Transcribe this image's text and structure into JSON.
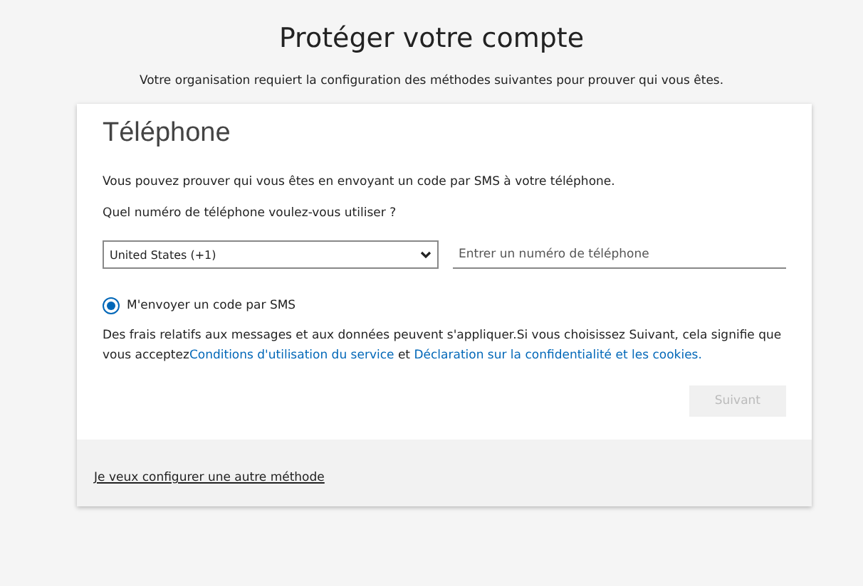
{
  "header": {
    "title": "Protéger votre compte",
    "subtitle": "Votre organisation requiert la configuration des méthodes suivantes pour prouver qui vous êtes."
  },
  "card": {
    "heading": "Téléphone",
    "intro": "Vous pouvez prouver qui vous êtes en envoyant un code par SMS à votre téléphone.",
    "question": "Quel numéro de téléphone voulez-vous utiliser ?",
    "country_select": {
      "value": "United States (+1)"
    },
    "phone_field": {
      "placeholder": "Entrer un numéro de téléphone"
    },
    "options": [
      {
        "label": "M'envoyer un code par SMS",
        "selected": true
      }
    ],
    "consent": {
      "text": "Des frais relatifs aux messages et aux données peuvent s'appliquer.Si vous choisissez Suivant, cela signifie que vous acceptez",
      "link_1": "Conditions d'utilisation du service",
      "joiner": " et ",
      "link_2": "Déclaration sur la confidentialité et les cookies."
    },
    "next_button": {
      "label": "Suivant",
      "disabled": true
    },
    "footer_link": "Je veux configurer une autre méthode"
  }
}
